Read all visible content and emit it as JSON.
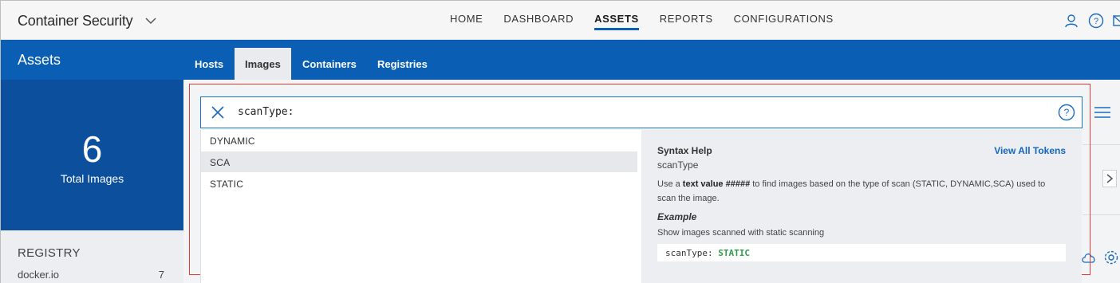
{
  "header": {
    "app_title": "Container Security",
    "nav": [
      {
        "label": "HOME",
        "active": false
      },
      {
        "label": "DASHBOARD",
        "active": false
      },
      {
        "label": "ASSETS",
        "active": true
      },
      {
        "label": "REPORTS",
        "active": false
      },
      {
        "label": "CONFIGURATIONS",
        "active": false
      }
    ],
    "icons": [
      "user-icon",
      "help-icon",
      "mail-icon"
    ]
  },
  "band": {
    "title": "Assets",
    "tabs": [
      {
        "label": "Hosts",
        "active": false
      },
      {
        "label": "Images",
        "active": true
      },
      {
        "label": "Containers",
        "active": false
      },
      {
        "label": "Registries",
        "active": false
      }
    ]
  },
  "summary": {
    "total_value": "6",
    "total_label": "Total Images"
  },
  "registry": {
    "title": "REGISTRY",
    "rows": [
      {
        "name": "docker.io",
        "count": "7"
      }
    ]
  },
  "search": {
    "value": "scanType:",
    "suggestions": [
      {
        "label": "DYNAMIC",
        "selected": false
      },
      {
        "label": "SCA",
        "selected": true
      },
      {
        "label": "STATIC",
        "selected": false
      }
    ]
  },
  "syntax_help": {
    "title": "Syntax Help",
    "link": "View All Tokens",
    "field": "scanType",
    "desc_pre": "Use a ",
    "desc_bold": "text value #####",
    "desc_post": " to find images based on the type of scan (STATIC, DYNAMIC,SCA) used to scan the image.",
    "example_title": "Example",
    "example_desc": "Show images scanned with static scanning",
    "code_key": "scanType:",
    "code_value": "STATIC"
  },
  "colors": {
    "brand_blue": "#0a5fb4",
    "card_blue": "#0c4f9c",
    "highlight_red": "#e53935",
    "code_green": "#2e9e4a"
  }
}
